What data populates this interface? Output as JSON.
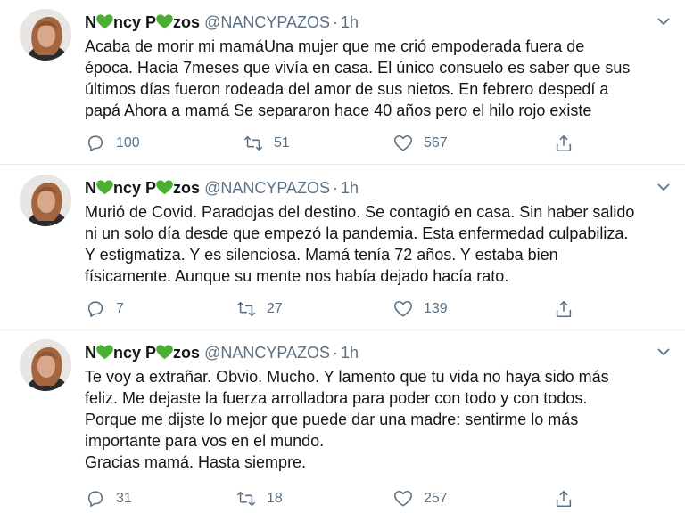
{
  "accent_color": "#1da1f2",
  "heart_color": "#4caf35",
  "tweets": [
    {
      "name_parts": [
        "N",
        "ncy P",
        "zos"
      ],
      "handle": "@NANCYPAZOS",
      "separator": "·",
      "time": "1h",
      "lines": [
        "Acaba de morir mi mamáUna mujer que me crió empoderada fuera de",
        "época. Hacia 7meses que vivía en casa.  El único consuelo es saber que sus",
        "últimos días fueron rodeada del amor de sus nietos. En febrero despedí a",
        "papá Ahora a mamá Se separaron hace 40 años pero el hilo rojo existe"
      ],
      "replies": "100",
      "retweets": "51",
      "likes": "567"
    },
    {
      "name_parts": [
        "N",
        "ncy P",
        "zos"
      ],
      "handle": "@NANCYPAZOS",
      "separator": "·",
      "time": "1h",
      "lines": [
        "Murió de Covid. Paradojas del destino. Se contagió en casa. Sin haber salido",
        "ni un solo día desde que empezó la pandemia. Esta enfermedad culpabiliza.",
        "Y estigmatiza. Y es silenciosa. Mamá tenía 72 años. Y estaba bien",
        "físicamente. Aunque su mente nos había dejado hacía rato."
      ],
      "replies": "7",
      "retweets": "27",
      "likes": "139"
    },
    {
      "name_parts": [
        "N",
        "ncy P",
        "zos"
      ],
      "handle": "@NANCYPAZOS",
      "separator": "·",
      "time": "1h",
      "lines": [
        "Te voy a extrañar. Obvio. Mucho. Y lamento que tu vida no haya sido más",
        "feliz. Me dejaste la fuerza arrolladora para poder con todo y con todos.",
        "Porque me dijste lo mejor que puede dar una madre: sentirme lo más",
        "importante para vos en el mundo.",
        "Gracias mamá. Hasta siempre."
      ],
      "replies": "31",
      "retweets": "18",
      "likes": "257"
    }
  ]
}
